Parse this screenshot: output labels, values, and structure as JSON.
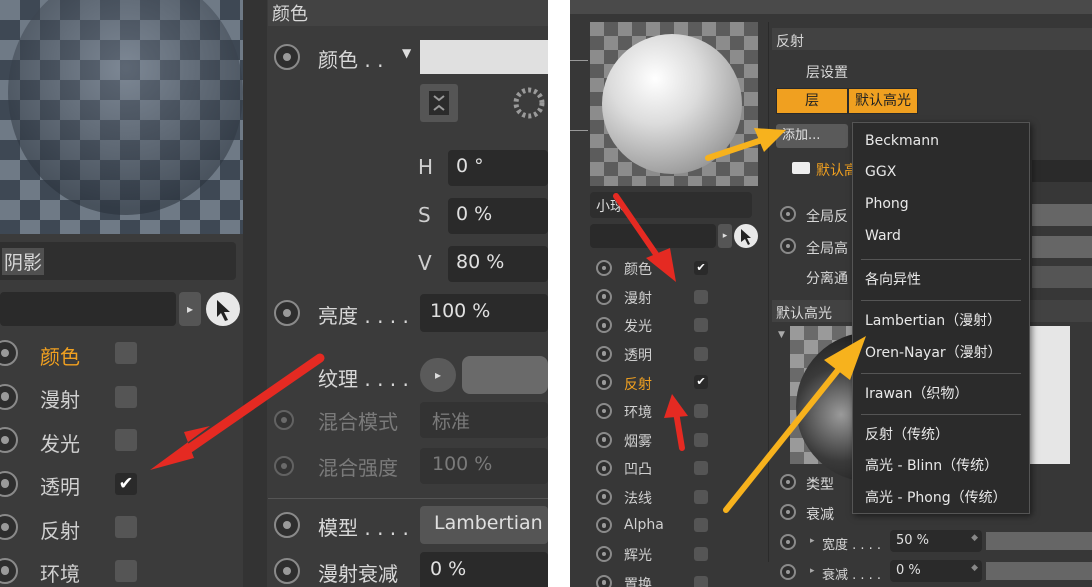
{
  "left": {
    "section_title": "颜色",
    "color_label": "颜色 . .",
    "shadow_field": "阴影",
    "h_label": "H",
    "h_value": "0 °",
    "s_label": "S",
    "s_value": "0 %",
    "v_label": "V",
    "v_value": "80 %",
    "brightness_label": "亮度 . . . .",
    "brightness_value": "100 %",
    "texture_label": "纹理 . . . .",
    "blend_mode_label": "混合模式",
    "blend_mode_value": "标准",
    "blend_strength_label": "混合强度",
    "blend_strength_value": "100 %",
    "model_label": "模型 . . . .",
    "model_value": "Lambertian",
    "diffuse_falloff_label": "漫射衰减",
    "diffuse_falloff_value": "0 %",
    "channels": [
      {
        "label": "颜色",
        "checked": false,
        "active": true
      },
      {
        "label": "漫射",
        "checked": false,
        "active": false
      },
      {
        "label": "发光",
        "checked": false,
        "active": false
      },
      {
        "label": "透明",
        "checked": true,
        "active": false
      },
      {
        "label": "反射",
        "checked": false,
        "active": false
      },
      {
        "label": "环境",
        "checked": false,
        "active": false
      }
    ],
    "checkmark": "✔"
  },
  "right": {
    "section_title": "反射",
    "layer_settings": "层设置",
    "tab_layer": "层",
    "tab_default_spec": "默认高光",
    "add_button": "添加...",
    "default_label": "默认高",
    "material_name": "小球",
    "global_refl": "全局反",
    "global_spec": "全局高",
    "separate": "分离通",
    "default_spec_header": "默认高光",
    "type_label": "类型",
    "falloff_label": "衰减",
    "width_label": "宽度 . . . .",
    "width_value": "50 %",
    "falloff2_label": "衰减 . . . .",
    "falloff2_value": "0 %",
    "channels": [
      {
        "label": "颜色",
        "checked": true,
        "active": false
      },
      {
        "label": "漫射",
        "checked": false,
        "active": false
      },
      {
        "label": "发光",
        "checked": false,
        "active": false
      },
      {
        "label": "透明",
        "checked": false,
        "active": false
      },
      {
        "label": "反射",
        "checked": true,
        "active": true
      },
      {
        "label": "环境",
        "checked": false,
        "active": false
      },
      {
        "label": "烟雾",
        "checked": false,
        "active": false
      },
      {
        "label": "凹凸",
        "checked": false,
        "active": false
      },
      {
        "label": "法线",
        "checked": false,
        "active": false
      },
      {
        "label": "Alpha",
        "checked": false,
        "active": false
      },
      {
        "label": "辉光",
        "checked": false,
        "active": false
      },
      {
        "label": "置换",
        "checked": false,
        "active": false
      }
    ],
    "menu": [
      "Beckmann",
      "GGX",
      "Phong",
      "Ward",
      "各向异性",
      "Lambertian（漫射）",
      "Oren-Nayar（漫射）",
      "Irawan（织物）",
      "反射（传统）",
      "高光 - Blinn（传统）",
      "高光 - Phong（传统）"
    ],
    "checkmark": "✔"
  },
  "colors": {
    "accent_orange": "#f0a020",
    "annotation_red": "#e52a22",
    "annotation_yellow": "#f7b21d"
  }
}
